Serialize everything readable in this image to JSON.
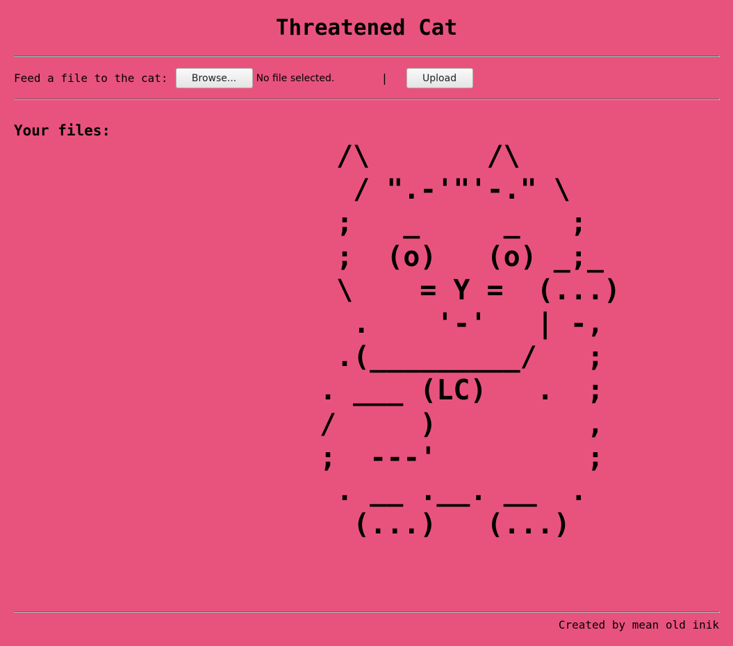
{
  "header": {
    "title": "Threatened Cat"
  },
  "upload_form": {
    "label": "Feed a file to the cat:",
    "browse_label": "Browse...",
    "file_status": "No file selected.",
    "separator": "|",
    "upload_label": "Upload"
  },
  "files": {
    "heading": "Your files:"
  },
  "cat_art": {
    "text": " /\\       /\\\n  / \".-'\"'-.\" \\\n ;   _     _   ;\n ;  (o)   (o) _;_\n \\    = Y =  (...)\n  .    '-'   | -,\n .(_________/   ;\n. ___ (LC)   .  ;\n/     )         ,\n;  ---'         ;\n . __ .__. __  .\n  (...)   (...)"
  },
  "footer": {
    "credit": "Created by mean old inik"
  }
}
